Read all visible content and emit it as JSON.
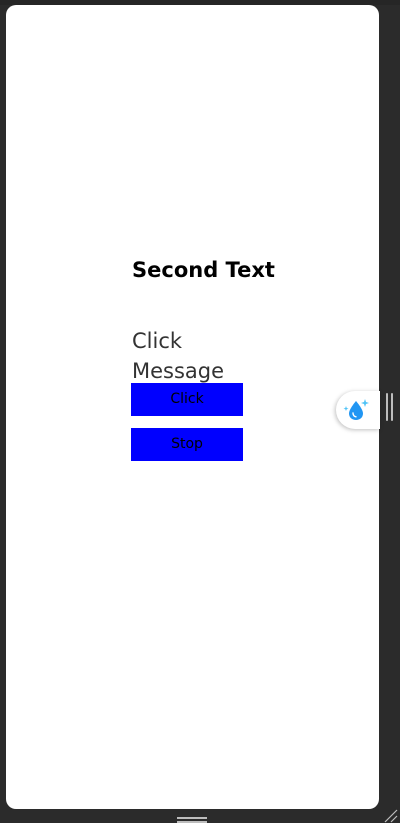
{
  "screen": {
    "title": "Second Text",
    "message": "Click Message"
  },
  "buttons": {
    "click_label": "Click",
    "stop_label": "Stop"
  },
  "colors": {
    "button_background": "#0000ff",
    "button_text": "#000000",
    "page_background": "#ffffff",
    "chrome_background": "#2b2b2b",
    "widget_icon": "#2196f3"
  },
  "icons": {
    "floating_widget": "water-drop-sparkle-icon",
    "side_handle": "drag-handle-vertical-icon",
    "bottom_handle": "drag-handle-horizontal-icon",
    "corner": "resize-grip-icon"
  }
}
